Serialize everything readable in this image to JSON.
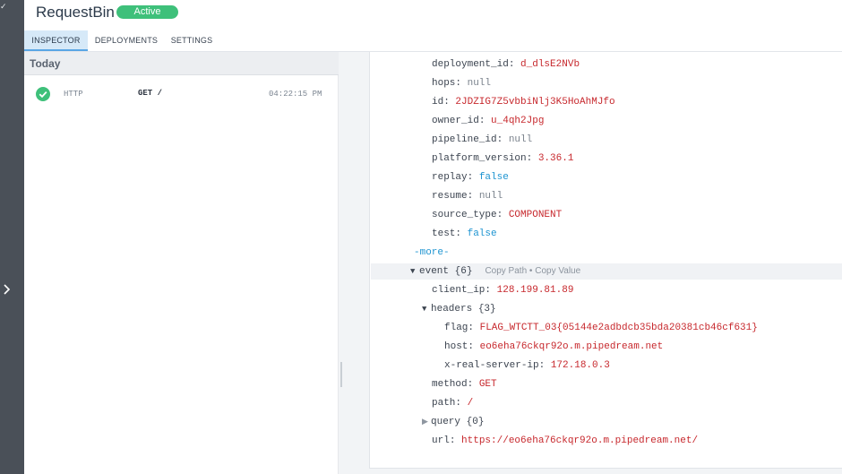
{
  "app": {
    "title": "RequestBin",
    "status": "Active"
  },
  "tabs": [
    {
      "label": "INSPECTOR",
      "active": true
    },
    {
      "label": "DEPLOYMENTS",
      "active": false
    },
    {
      "label": "SETTINGS",
      "active": false
    }
  ],
  "list": {
    "group_label": "Today",
    "events": [
      {
        "status_icon": "check-circle-icon",
        "type": "HTTP",
        "method": "GET /",
        "time": "04:22:15 PM"
      }
    ]
  },
  "detail": {
    "context": [
      {
        "key": "deployment_id",
        "value": "d_dlsE2NVb",
        "kind": "string"
      },
      {
        "key": "hops",
        "value": "null",
        "kind": "null"
      },
      {
        "key": "id",
        "value": "2JDZIG7Z5vbbiNlj3K5HoAhMJfo",
        "kind": "string"
      },
      {
        "key": "owner_id",
        "value": "u_4qh2Jpg",
        "kind": "string"
      },
      {
        "key": "pipeline_id",
        "value": "null",
        "kind": "null"
      },
      {
        "key": "platform_version",
        "value": "3.36.1",
        "kind": "string"
      },
      {
        "key": "replay",
        "value": "false",
        "kind": "bool"
      },
      {
        "key": "resume",
        "value": "null",
        "kind": "null"
      },
      {
        "key": "source_type",
        "value": "COMPONENT",
        "kind": "string"
      },
      {
        "key": "test",
        "value": "false",
        "kind": "bool"
      }
    ],
    "more_label": "-more-",
    "event": {
      "key": "event",
      "count": "{6}",
      "copy_path": "Copy Path",
      "separator": "•",
      "copy_value": "Copy Value",
      "client_ip_key": "client_ip",
      "client_ip": "128.199.81.89",
      "headers_key": "headers",
      "headers_count": "{3}",
      "headers": [
        {
          "key": "flag",
          "value": "FLAG_WTCTT_03{05144e2adbdcb35bda20381cb46cf631}"
        },
        {
          "key": "host",
          "value": "eo6eha76ckqr92o.m.pipedream.net"
        },
        {
          "key": "x-real-server-ip",
          "value": "172.18.0.3"
        }
      ],
      "method_key": "method",
      "method": "GET",
      "path_key": "path",
      "path": "/",
      "query_key": "query",
      "query_count": "{0}",
      "url_key": "url",
      "url": "https://eo6eha76ckqr92o.m.pipedream.net/"
    }
  },
  "colors": {
    "accent": "#3ec07a",
    "tab_active": "#d6e9f8",
    "string": "#c7282d",
    "bool": "#1e94d1",
    "rail": "#4a5058"
  }
}
